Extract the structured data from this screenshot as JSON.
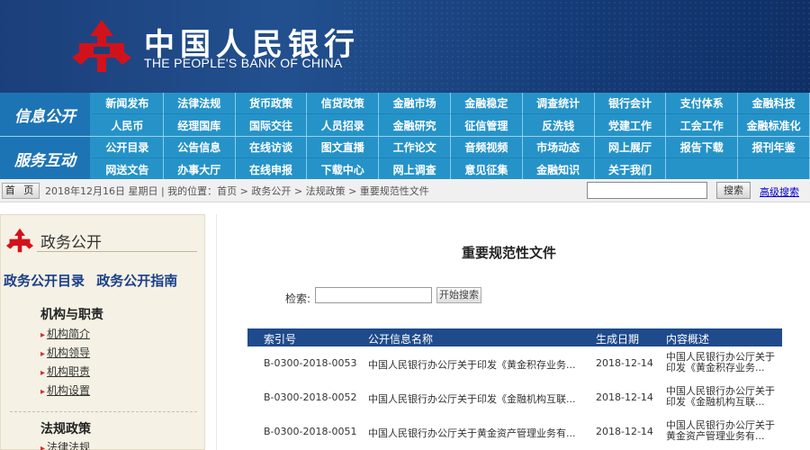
{
  "header": {
    "bank_name_cn": "中国人民银行",
    "bank_name_en": "THE PEOPLE'S BANK OF CHINA",
    "brand_color": "#d2121b"
  },
  "nav": {
    "group1_title": "信息公开",
    "group1_items": [
      "新闻发布",
      "法律法规",
      "货币政策",
      "信贷政策",
      "金融市场",
      "金融稳定",
      "调查统计",
      "银行会计",
      "支付体系",
      "金融科技",
      "人民币",
      "经理国库",
      "国际交往",
      "人员招录",
      "金融研究",
      "征信管理",
      "反洗钱",
      "党建工作",
      "工会工作",
      "金融标准化"
    ],
    "group2_title": "服务互动",
    "group2_items": [
      "公开目录",
      "公告信息",
      "在线访谈",
      "图文直播",
      "工作论文",
      "音频视频",
      "市场动态",
      "网上展厅",
      "报告下载",
      "报刊年鉴",
      "网送文告",
      "办事大厅",
      "在线申报",
      "下载中心",
      "网上调查",
      "意见征集",
      "金融知识",
      "关于我们",
      "",
      ""
    ]
  },
  "breadcrumb": {
    "home_label": "首 页",
    "text": "2018年12月16日 星期日 | 我的位置：首页 > 政务公开 > 法规政策 > 重要规范性文件",
    "search_button": "搜索",
    "advanced_search": "高级搜索"
  },
  "left": {
    "title": "政务公开",
    "link1": "政务公开目录",
    "link2": "政务公开指南",
    "section1": "机构与职责",
    "items1": [
      "机构简介",
      "机构领导",
      "机构职责",
      "机构设置"
    ],
    "section2": "法规政策",
    "items2": [
      "法律法规"
    ]
  },
  "main": {
    "title": "重要规范性文件",
    "search_label": "检索:",
    "search_button": "开始搜索",
    "columns": [
      "索引号",
      "公开信息名称",
      "生成日期",
      "内容概述"
    ],
    "rows": [
      {
        "index": "B-0300-2018-0053",
        "name": "中国人民银行办公厅关于印发《黄金积存业务...",
        "date": "2018-12-14",
        "summary_line1": "中国人民银行办公厅关于",
        "summary_line2": "印发《黄金积存业务..."
      },
      {
        "index": "B-0300-2018-0052",
        "name": "中国人民银行办公厅关于印发《金融机构互联...",
        "date": "2018-12-14",
        "summary_line1": "中国人民银行办公厅关于",
        "summary_line2": "印发《金融机构互联..."
      },
      {
        "index": "B-0300-2018-0051",
        "name": "中国人民银行办公厅关于黄金资产管理业务有...",
        "date": "2018-12-14",
        "summary_line1": "中国人民银行办公厅关于",
        "summary_line2": "黄金资产管理业务有..."
      }
    ]
  }
}
